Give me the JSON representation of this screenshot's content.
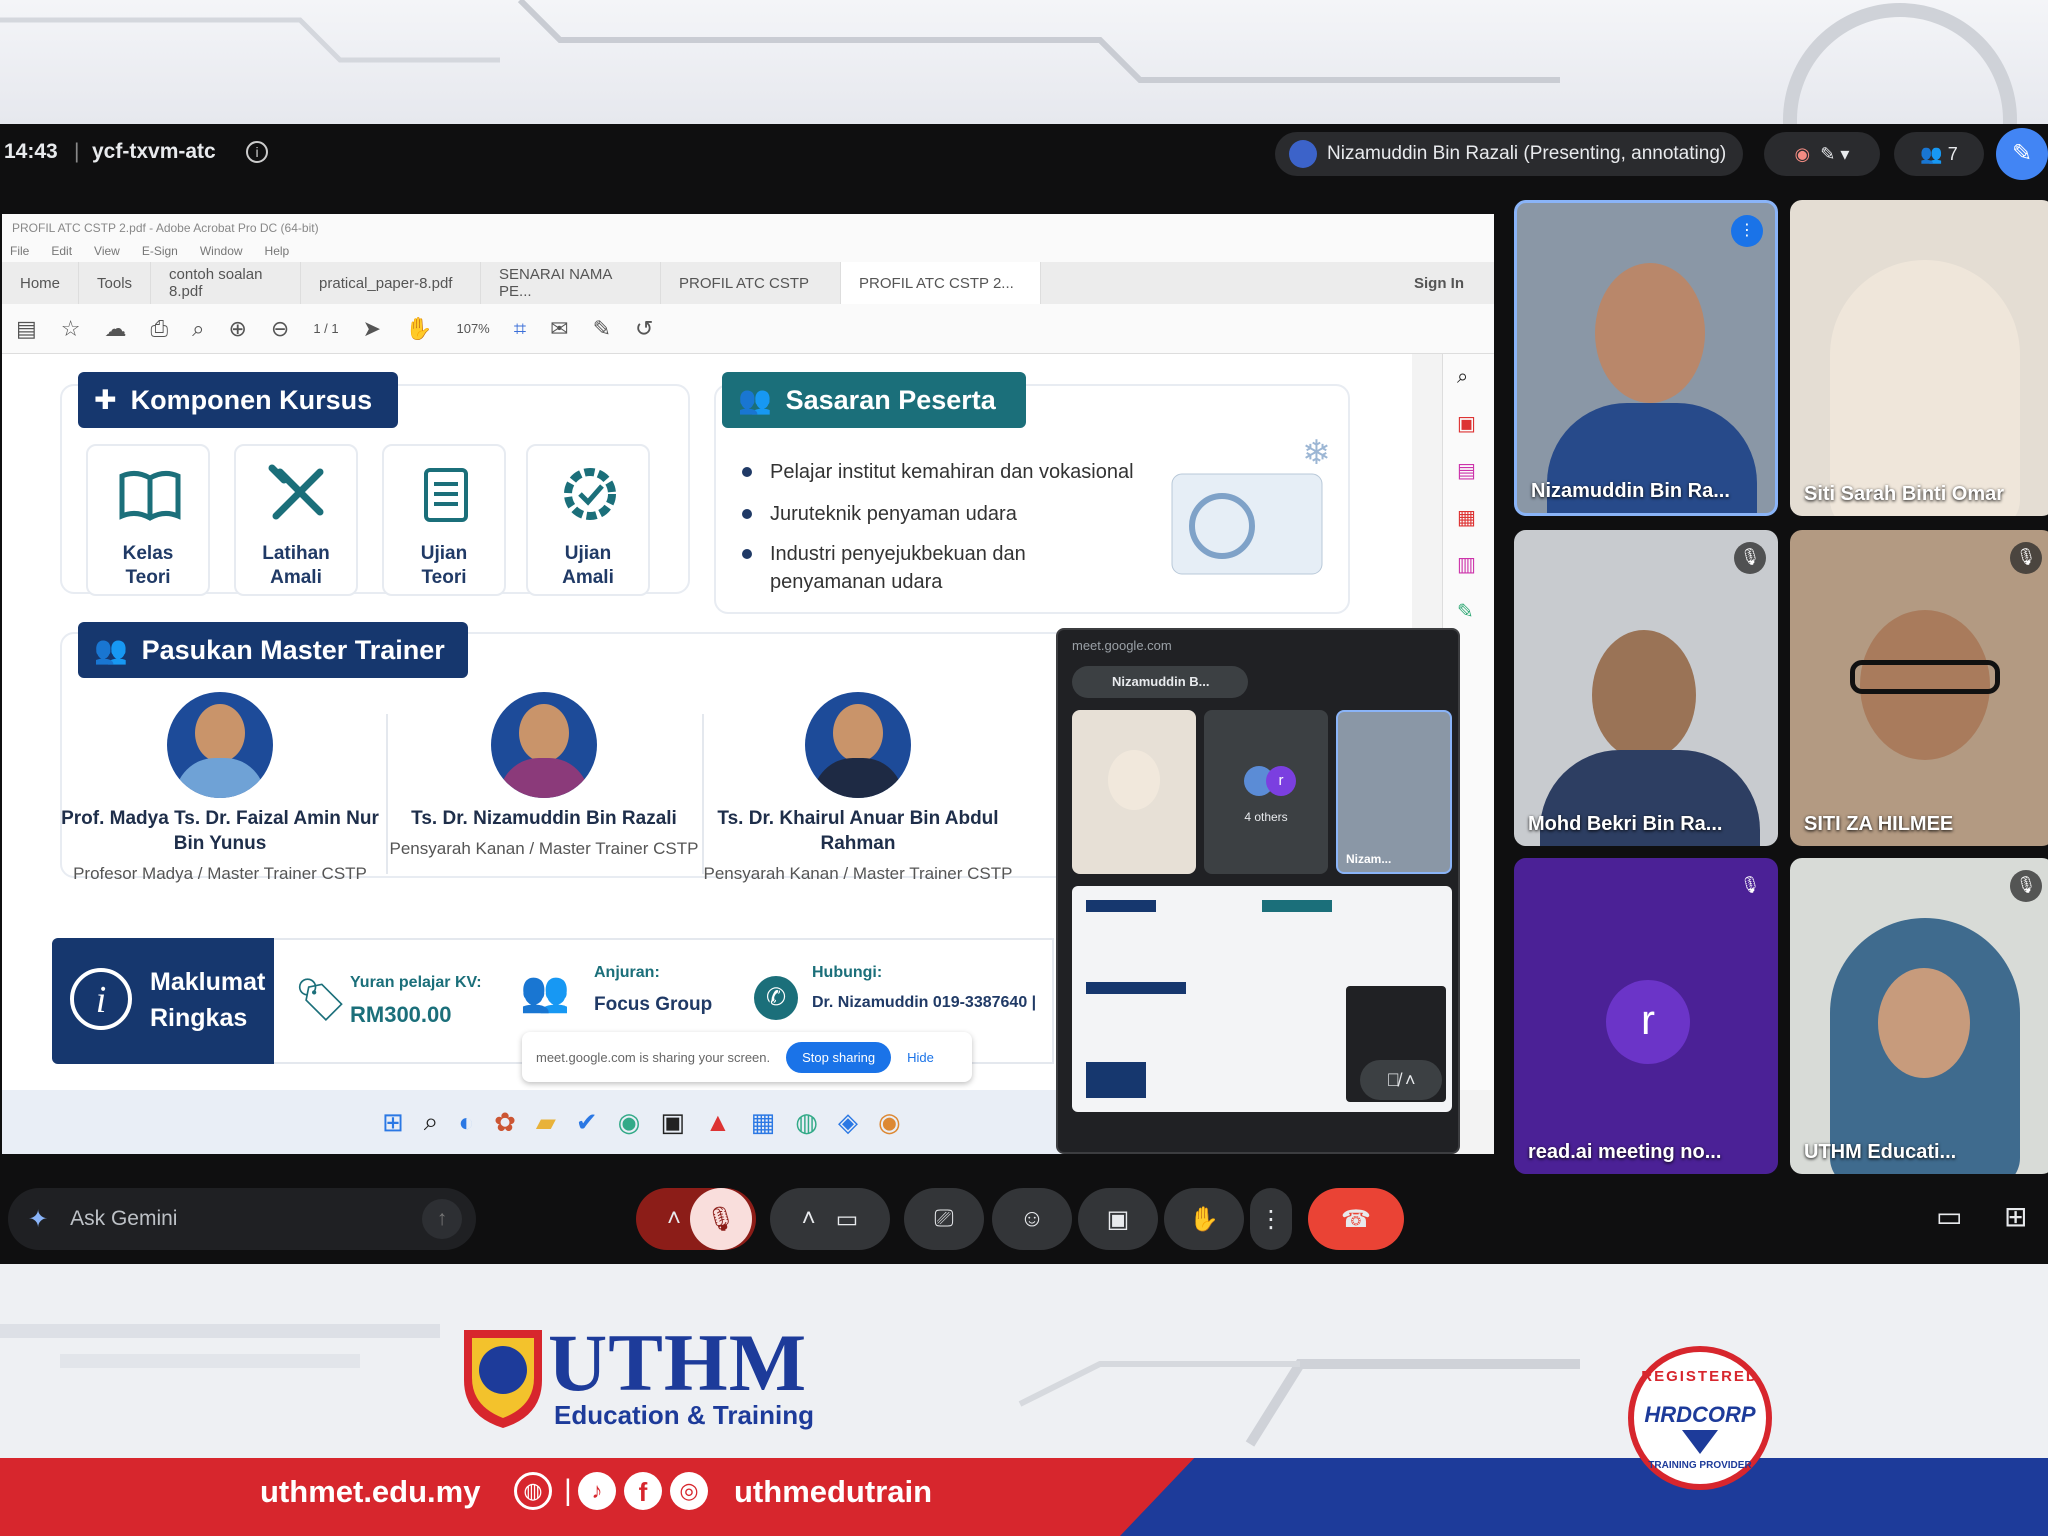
{
  "meet": {
    "time": "14:43",
    "meeting_code": "ycf-txvm-atc",
    "presenter_status": "Nizamuddin Bin Razali (Presenting, annotating)",
    "participant_count": "7",
    "ask_gemini": "Ask Gemini"
  },
  "acrobat": {
    "window_title": "PROFIL ATC CSTP 2.pdf - Adobe Acrobat Pro DC (64-bit)",
    "menu": [
      "File",
      "Edit",
      "View",
      "E-Sign",
      "Window",
      "Help"
    ],
    "tabs": [
      "Home",
      "Tools",
      "contoh soalan 8.pdf",
      "pratical_paper-8.pdf",
      "SENARAI NAMA PE...",
      "PROFIL ATC CSTP",
      "PROFIL ATC CSTP 2..."
    ],
    "sign_in": "Sign In",
    "page_nav": "1 / 1",
    "zoom": "107%"
  },
  "doc": {
    "komponen_title": "Komponen Kursus",
    "komponen": [
      {
        "l1": "Kelas",
        "l2": "Teori"
      },
      {
        "l1": "Latihan",
        "l2": "Amali"
      },
      {
        "l1": "Ujian",
        "l2": "Teori"
      },
      {
        "l1": "Ujian",
        "l2": "Amali"
      }
    ],
    "sasaran_title": "Sasaran Peserta",
    "sasaran": [
      "Pelajar institut kemahiran dan vokasional",
      "Juruteknik penyaman udara",
      "Industri penyejukbekuan dan penyamanan udara"
    ],
    "trainer_title": "Pasukan Master Trainer",
    "trainers": [
      {
        "name": "Prof. Madya Ts. Dr. Faizal Amin Nur Bin Yunus",
        "role": "Profesor Madya / Master Trainer CSTP"
      },
      {
        "name": "Ts. Dr. Nizamuddin Bin Razali",
        "role": "Pensyarah Kanan / Master Trainer CSTP"
      },
      {
        "name": "Ts. Dr. Khairul Anuar Bin Abdul Rahman",
        "role": "Pensyarah Kanan / Master Trainer CSTP"
      }
    ],
    "info_title_1": "Maklumat",
    "info_title_2": "Ringkas",
    "yuran_label": "Yuran pelajar KV:",
    "yuran_value": "RM300.00",
    "anjuran_label": "Anjuran:",
    "anjuran_value": "Focus Group",
    "hubungi_label": "Hubungi:",
    "hubungi_value": "Dr. Nizamuddin  019-3387640 |"
  },
  "share_note": {
    "text": "meet.google.com is sharing your screen.",
    "stop": "Stop sharing",
    "hide": "Hide"
  },
  "pip": {
    "url": "meet.google.com",
    "presenter": "Nizamuddin B...",
    "others": "4 others",
    "self_label": "Nizam...",
    "avatar_letter": "r"
  },
  "tiles": [
    {
      "name": "Nizamuddin Bin Ra...",
      "color": "#8a97a6"
    },
    {
      "name": "Siti Sarah Binti Omar",
      "color": "#e4ddd3"
    },
    {
      "name": "Mohd Bekri Bin Ra...",
      "color": "#c8cbcf"
    },
    {
      "name": "SITI ZA HILMEE",
      "color": "#b39a82"
    },
    {
      "name": "read.ai meeting no...",
      "color": "#4b2196",
      "letter": "r"
    },
    {
      "name": "UTHM Educati...",
      "color": "#d8dbd7"
    }
  ],
  "footer": {
    "brand": "UTHM",
    "brand_sub": "Education & Training",
    "website": "uthmet.edu.my",
    "handle": "uthmedutrain",
    "badge_top": "REGISTERED",
    "badge_mid": "HRDCORP",
    "badge_bottom": "TRAINING PROVIDER"
  },
  "colors": {
    "navy": "#16376e",
    "teal": "#1b6f7a",
    "red": "#d7262d",
    "blue": "#1d3b9a",
    "end_call": "#ea4335"
  }
}
